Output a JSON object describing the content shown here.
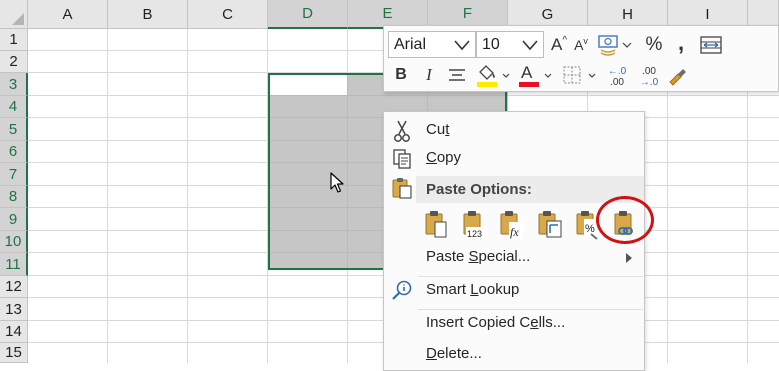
{
  "sheet": {
    "columns": [
      "A",
      "B",
      "C",
      "D",
      "E",
      "F",
      "G",
      "H",
      "I"
    ],
    "rows": [
      "1",
      "2",
      "3",
      "4",
      "5",
      "6",
      "7",
      "8",
      "9",
      "10",
      "11",
      "12",
      "13",
      "14",
      "15"
    ],
    "selection": "D3:F11",
    "accent_color": "#217346"
  },
  "mini_toolbar": {
    "font_name": "Arial",
    "font_size": "10",
    "increase_font_label": "A",
    "decrease_font_label": "A",
    "percent_label": "%",
    "comma_label": ",",
    "bold_label": "B",
    "italic_label": "I",
    "font_color_label": "A",
    "font_color": "#e81123",
    "highlight_color": "#ffeb00",
    "increase_decimal_top": "←.0",
    "increase_decimal_bottom": ".00",
    "decrease_decimal_top": ".00",
    "decrease_decimal_bottom": "→.0"
  },
  "context_menu": {
    "cut": {
      "pre": "Cu",
      "accel": "t",
      "post": ""
    },
    "copy": {
      "pre": "",
      "accel": "C",
      "post": "opy"
    },
    "paste_options_header": "Paste Options:",
    "paste_options": [
      {
        "name": "paste",
        "text": ""
      },
      {
        "name": "values",
        "text": "123"
      },
      {
        "name": "formulas",
        "text": "fx"
      },
      {
        "name": "transpose",
        "text": ""
      },
      {
        "name": "formatting",
        "text": "%"
      },
      {
        "name": "paste-link",
        "text": ""
      }
    ],
    "paste_special": {
      "pre": "Paste ",
      "accel": "S",
      "post": "pecial..."
    },
    "smart_lookup": {
      "pre": "Smart ",
      "accel": "L",
      "post": "ookup"
    },
    "insert_copied_cells": {
      "pre": "Insert Copied C",
      "accel": "e",
      "post": "lls..."
    },
    "delete": {
      "pre": "",
      "accel": "D",
      "post": "elete..."
    },
    "highlight_color": "#d11212"
  }
}
